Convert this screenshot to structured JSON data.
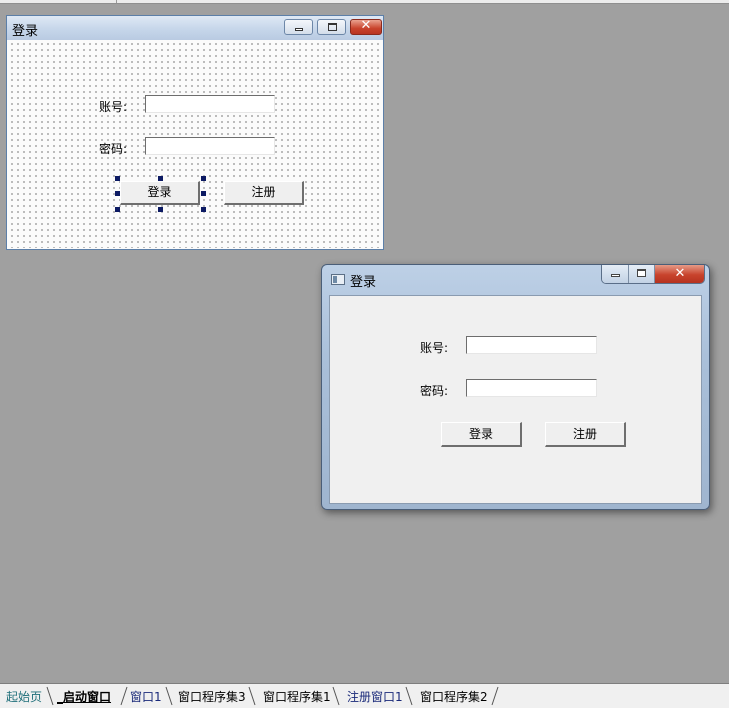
{
  "designer": {
    "title": "登录",
    "account_label": "账号:",
    "password_label": "密码:",
    "login_button": "登录",
    "register_button": "注册",
    "close_glyph": "✕"
  },
  "preview": {
    "title": "登录",
    "account_label": "账号:",
    "password_label": "密码:",
    "login_button": "登录",
    "register_button": "注册",
    "close_glyph": "✕"
  },
  "tabs": [
    {
      "label": "起始页",
      "color": "#1f6f7a"
    },
    {
      "label": "_启动窗口",
      "color": "#000000",
      "active": true
    },
    {
      "label": "窗口1",
      "color": "#1a2a7a"
    },
    {
      "label": "窗口程序集3",
      "color": "#000000"
    },
    {
      "label": "窗口程序集1",
      "color": "#000000"
    },
    {
      "label": "注册窗口1",
      "color": "#1a2a7a"
    },
    {
      "label": "窗口程序集2",
      "color": "#000000"
    }
  ],
  "colors": {
    "workspace": "#a0a0a0",
    "selection_handle": "#0c1a63",
    "close_button": "#c8432c"
  }
}
